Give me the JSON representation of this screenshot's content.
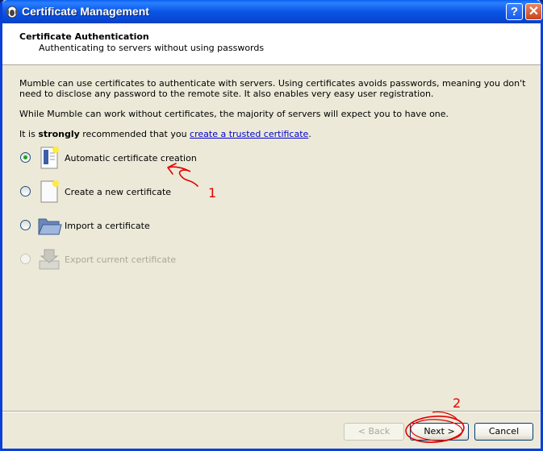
{
  "window": {
    "title": "Certificate Management",
    "help_label": "?",
    "close_label": "✕"
  },
  "header": {
    "title": "Certificate Authentication",
    "subtitle": "Authenticating to servers without using passwords"
  },
  "body": {
    "desc1": "Mumble can use certificates to authenticate with servers. Using certificates avoids passwords, meaning you don't need to disclose any password to the remote site. It also enables very easy user registration.",
    "desc2": "While Mumble can work without certificates, the majority of servers will expect you to have one.",
    "desc3_pre": "It is ",
    "desc3_strong": "strongly",
    "desc3_mid": " recommended that you ",
    "desc3_link": "create a trusted certificate",
    "desc3_post": "."
  },
  "options": [
    {
      "label": "Automatic certificate creation",
      "icon": "certificate-wizard-icon",
      "checked": true,
      "enabled": true
    },
    {
      "label": "Create a new certificate",
      "icon": "new-document-icon",
      "checked": false,
      "enabled": true
    },
    {
      "label": "Import a certificate",
      "icon": "folder-open-icon",
      "checked": false,
      "enabled": true
    },
    {
      "label": "Export current certificate",
      "icon": "export-icon",
      "checked": false,
      "enabled": false
    }
  ],
  "buttons": {
    "back": "< Back",
    "next": "Next >",
    "cancel": "Cancel"
  },
  "annotations": {
    "label1": "1",
    "label2": "2",
    "color": "#e00000"
  }
}
